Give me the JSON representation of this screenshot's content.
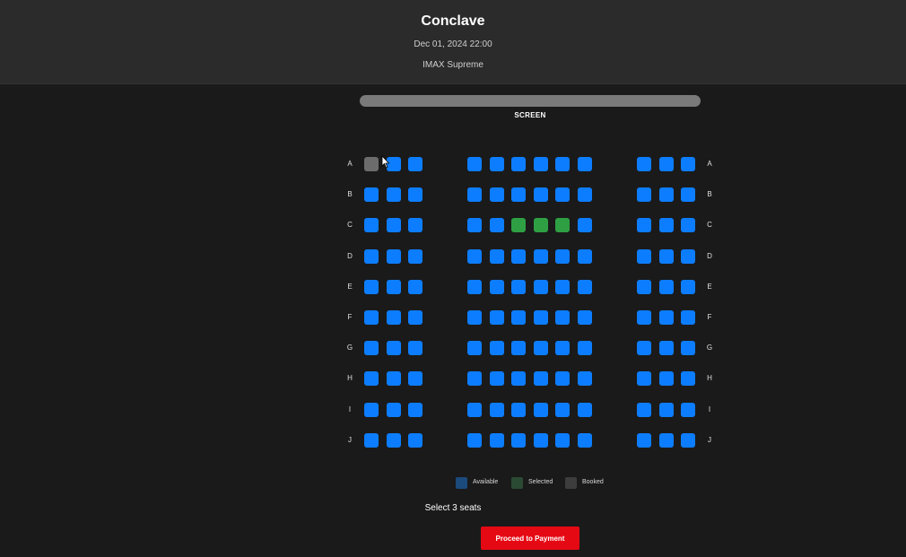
{
  "header": {
    "movie_title": "Conclave",
    "show_time": "Dec 01, 2024 22:00",
    "hall_name": "IMAX Supreme"
  },
  "screen": {
    "label": "SCREEN"
  },
  "seat_map": {
    "rows": [
      "A",
      "B",
      "C",
      "D",
      "E",
      "F",
      "G",
      "H",
      "I",
      "J"
    ],
    "sections": [
      {
        "name": "left",
        "seats_per_row": 3
      },
      {
        "name": "center",
        "seats_per_row": 6
      },
      {
        "name": "right",
        "seats_per_row": 3
      }
    ],
    "booked": [
      "A1"
    ],
    "selected": [
      "C6",
      "C7",
      "C8"
    ]
  },
  "legend": {
    "available": "Available",
    "selected": "Selected",
    "booked": "Booked"
  },
  "instruction": "Select 3 seats",
  "proceed_button": "Proceed to Payment",
  "colors": {
    "available": "#0d7dff",
    "selected": "#2ea043",
    "booked": "#6c6c6c",
    "legend_available": "#1b4a7c",
    "legend_selected": "#2b4a33",
    "legend_booked": "#3d3d3d",
    "accent": "#e50914"
  }
}
